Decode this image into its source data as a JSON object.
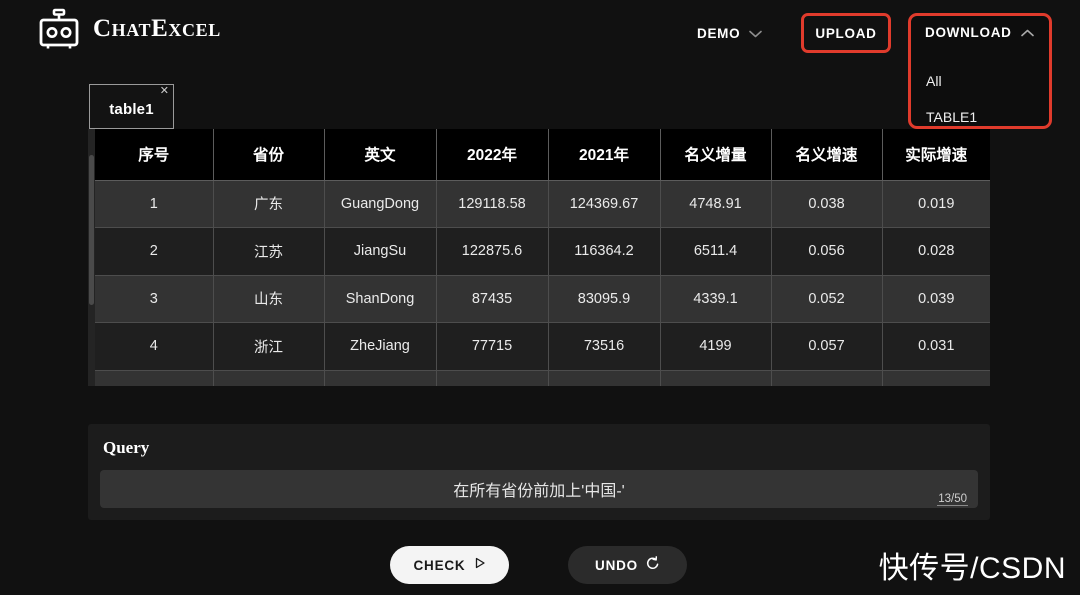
{
  "brand": {
    "name": "ChatExcel",
    "logo_icon": "robot-head-icon"
  },
  "header": {
    "demo": {
      "label": "DEMO",
      "icon": "chevron-down-icon"
    },
    "upload": {
      "label": "UPLOAD",
      "highlighted": true,
      "highlight_color": "#e03b2c"
    },
    "download": {
      "label": "DOWNLOAD",
      "icon": "chevron-up-icon",
      "expanded": true,
      "highlight_color": "#e03b2c",
      "items": [
        "All",
        "TABLE1"
      ]
    }
  },
  "tabs": [
    {
      "label": "table1",
      "active": true,
      "close_icon": "close-icon"
    }
  ],
  "table": {
    "headers": [
      "序号",
      "省份",
      "英文",
      "2022年",
      "2021年",
      "名义增量",
      "名义增速",
      "实际增速"
    ],
    "rows": [
      [
        "1",
        "广东",
        "GuangDong",
        "129118.58",
        "124369.67",
        "4748.91",
        "0.038",
        "0.019"
      ],
      [
        "2",
        "江苏",
        "JiangSu",
        "122875.6",
        "116364.2",
        "6511.4",
        "0.056",
        "0.028"
      ],
      [
        "3",
        "山东",
        "ShanDong",
        "87435",
        "83095.9",
        "4339.1",
        "0.052",
        "0.039"
      ],
      [
        "4",
        "浙江",
        "ZheJiang",
        "77715",
        "73516",
        "4199",
        "0.057",
        "0.031"
      ]
    ]
  },
  "query": {
    "title": "Query",
    "value": "在所有省份前加上'中国-'",
    "placeholder": "",
    "counter": "13/50"
  },
  "actions": {
    "check": {
      "label": "CHECK",
      "icon": "play-triangle-icon"
    },
    "undo": {
      "label": "UNDO",
      "icon": "undo-arrow-icon"
    }
  },
  "watermark": "快传号/CSDN",
  "colors": {
    "page_background": "#111111",
    "accent_red": "#e03b2c",
    "row_light": "#333333",
    "row_dark": "#1f1f1f",
    "header_row": "#000000"
  }
}
